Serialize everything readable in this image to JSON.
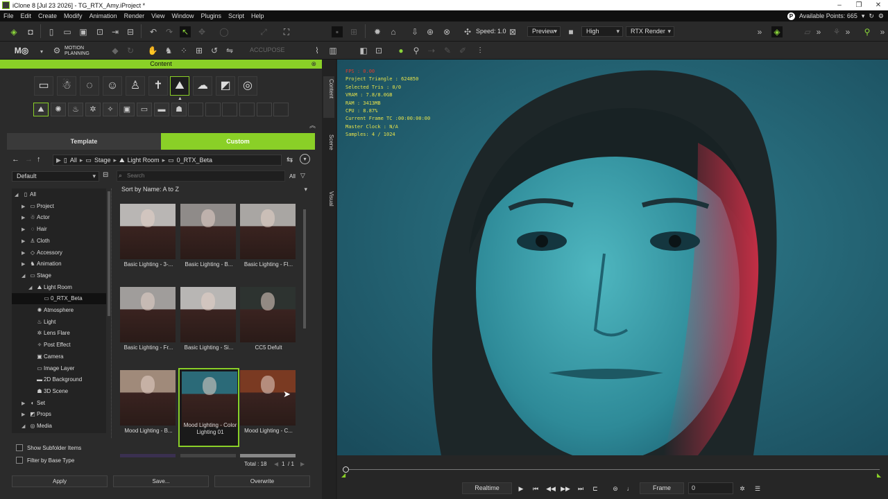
{
  "window": {
    "title": "iClone 8 [Jul 23 2026] - TG_RTX_Amy.iProject *",
    "controls": [
      "–",
      "❐",
      "✕"
    ]
  },
  "menu": {
    "items": [
      "File",
      "Edit",
      "Create",
      "Modify",
      "Animation",
      "Render",
      "View",
      "Window",
      "Plugins",
      "Script",
      "Help"
    ],
    "points_label": "Available Points: 665",
    "points_icon": "P"
  },
  "toolbar": {
    "speed_label": "Speed: 1.0",
    "preview": "Preview",
    "quality": "High",
    "render": "RTX Render",
    "motion_planning": "MOTION\nPLANNING",
    "accupose": "ACCUPOSE"
  },
  "content": {
    "title": "Content",
    "tabs": {
      "template": "Template",
      "custom": "Custom"
    },
    "path": [
      "All",
      "Stage",
      "Light Room",
      "0_RTX_Beta"
    ],
    "preset": "Default",
    "search_placeholder": "Search",
    "filter": "All",
    "sort": "Sort by Name: A to Z",
    "tree": [
      {
        "label": "All",
        "level": 0,
        "arrow": "◢"
      },
      {
        "label": "Project",
        "level": 1,
        "arrow": "▶"
      },
      {
        "label": "Actor",
        "level": 1,
        "arrow": "▶"
      },
      {
        "label": "Hair",
        "level": 1,
        "arrow": "▶"
      },
      {
        "label": "Cloth",
        "level": 1,
        "arrow": "▶"
      },
      {
        "label": "Accessory",
        "level": 1,
        "arrow": "▶"
      },
      {
        "label": "Animation",
        "level": 1,
        "arrow": "▶"
      },
      {
        "label": "Stage",
        "level": 1,
        "arrow": "◢"
      },
      {
        "label": "Light Room",
        "level": 2,
        "arrow": "◢"
      },
      {
        "label": "0_RTX_Beta",
        "level": 3,
        "arrow": "",
        "selected": true
      },
      {
        "label": "Atmosphere",
        "level": 2,
        "arrow": ""
      },
      {
        "label": "Light",
        "level": 2,
        "arrow": ""
      },
      {
        "label": "Lens Flare",
        "level": 2,
        "arrow": ""
      },
      {
        "label": "Post Effect",
        "level": 2,
        "arrow": ""
      },
      {
        "label": "Camera",
        "level": 2,
        "arrow": ""
      },
      {
        "label": "Image Layer",
        "level": 2,
        "arrow": ""
      },
      {
        "label": "2D Background",
        "level": 2,
        "arrow": ""
      },
      {
        "label": "3D Scene",
        "level": 2,
        "arrow": ""
      },
      {
        "label": "Set",
        "level": 1,
        "arrow": "▶"
      },
      {
        "label": "Props",
        "level": 1,
        "arrow": "▶"
      },
      {
        "label": "Media",
        "level": 1,
        "arrow": "◢"
      }
    ],
    "items": [
      {
        "label": "Basic Lighting - 3-...",
        "tone": "#b9b6b4"
      },
      {
        "label": "Basic Lighting - B...",
        "tone": "#8f8b89"
      },
      {
        "label": "Basic Lighting - Fl...",
        "tone": "#a9a6a3"
      },
      {
        "label": "Basic Lighting - Fr...",
        "tone": "#a09d9b"
      },
      {
        "label": "Basic Lighting - Si...",
        "tone": "#b8b6b4"
      },
      {
        "label": "CC5 Defult",
        "tone": "#2d3330"
      },
      {
        "label": "Mood Lighting - B...",
        "tone": "#a08a7a"
      },
      {
        "label": "Mood Lighting - Color Lighting 01",
        "tone": "#2b6a78",
        "selected": true
      },
      {
        "label": "Mood Lighting - C...",
        "tone": "#7a3a22"
      }
    ],
    "total": "Total : 18",
    "page": "1",
    "page_total": "/ 1",
    "show_subfolder": "Show Subfolder Items",
    "filter_base": "Filter by Base Type",
    "apply": "Apply",
    "save": "Save...",
    "overwrite": "Overwrite"
  },
  "side_tabs": [
    "Content",
    "Scene",
    "Visual"
  ],
  "viewport_stats": {
    "fps": "FPS : 0.00",
    "lines": [
      "Project Triangle : 624850",
      "Selected Tris : 0/0",
      "VRAM : 7.8/8.0GB",
      "RAM : 3413MB",
      "CPU : 8.87%",
      "Current Frame TC :00:00:00:00",
      "Master Clock : N/A",
      "Samples: 4 / 1024"
    ]
  },
  "playback": {
    "mode": "Realtime",
    "unit": "Frame",
    "frame": "0"
  },
  "colors": {
    "accent": "#8ad027",
    "stats": "#e8e34a",
    "fps": "#e23a2a"
  }
}
